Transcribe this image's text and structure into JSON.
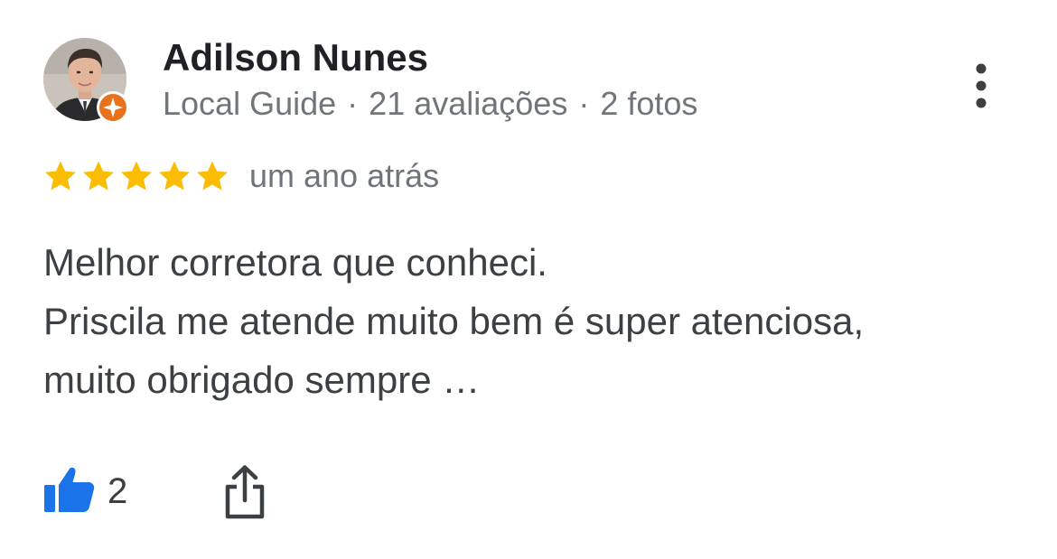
{
  "reviewer": {
    "name": "Adilson Nunes",
    "badge": "Local Guide",
    "separator": "·",
    "reviews_count": "21 avaliações",
    "photos_count": "2 fotos"
  },
  "rating": {
    "stars": 5,
    "max_stars": 5,
    "time_ago": "um ano atrás"
  },
  "review": {
    "lines": [
      "Melhor corretora que conheci.",
      "Priscila me atende muito bem é super atenciosa,",
      "muito obrigado sempre …"
    ]
  },
  "actions": {
    "like_count": "2",
    "like_icon": "thumbs-up-icon",
    "share_icon": "share-icon",
    "more_icon": "more-vert-icon"
  },
  "colors": {
    "star": "#FBBC04",
    "like": "#1A73E8",
    "badge": "#E8711C",
    "secondary_text": "#70757A"
  }
}
